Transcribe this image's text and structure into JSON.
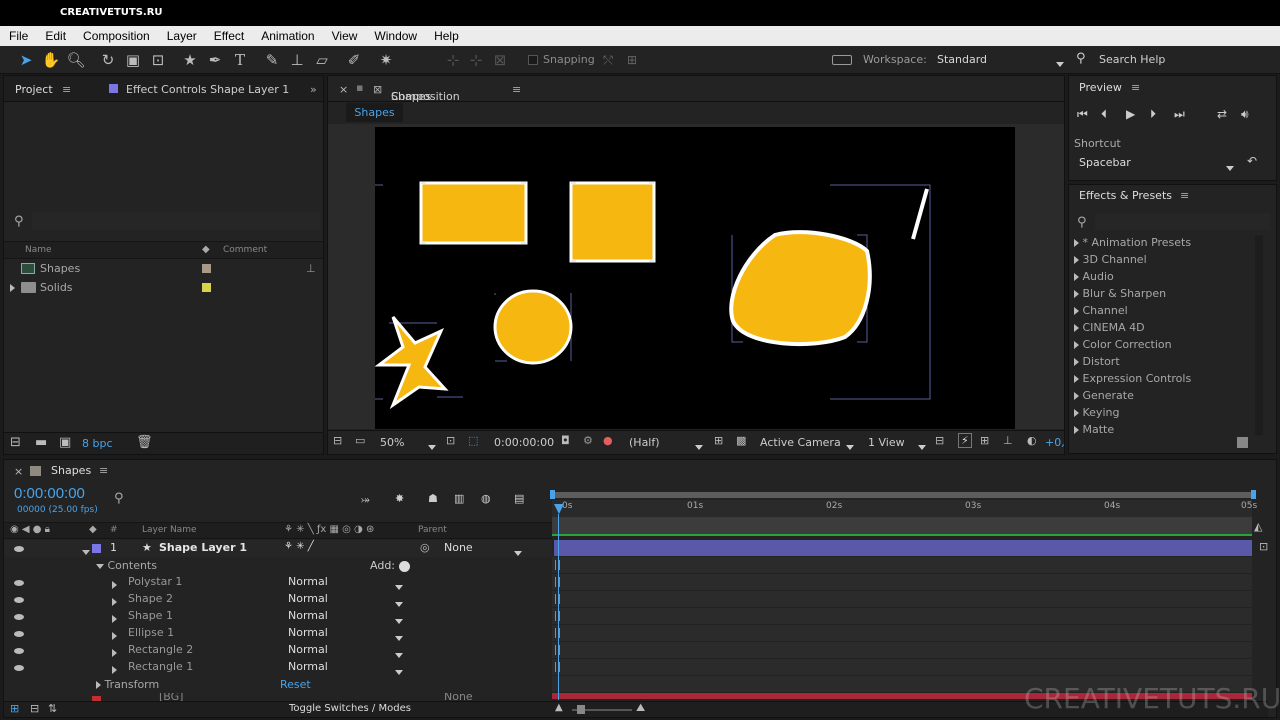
{
  "titlebar": {
    "title": "CREATIVETUTS.RU"
  },
  "menu": [
    "File",
    "Edit",
    "Composition",
    "Layer",
    "Effect",
    "Animation",
    "View",
    "Window",
    "Help"
  ],
  "toolbar": {
    "snapping": "Snapping",
    "workspace_label": "Workspace:",
    "workspace_value": "Standard",
    "search_help": "Search Help"
  },
  "project": {
    "tab_label": "Project",
    "effect_controls_tab": "Effect Controls Shape Layer 1",
    "col_name": "Name",
    "col_comment": "Comment",
    "items": [
      {
        "name": "Shapes",
        "color": "#a89a86"
      },
      {
        "name": "Solids",
        "color": "#d6d44a"
      }
    ],
    "bpc": "8 bpc"
  },
  "composition": {
    "tab_prefix": "Composition",
    "tab_name": "Shapes",
    "subtab": "Shapes",
    "zoom": "50%",
    "timecode": "0:00:00:00",
    "resolution": "(Half)",
    "camera": "Active Camera",
    "views": "1 View",
    "offset": "+0,"
  },
  "preview": {
    "title": "Preview",
    "shortcut_label": "Shortcut",
    "shortcut_value": "Spacebar"
  },
  "effects": {
    "title": "Effects & Presets",
    "items": [
      "* Animation Presets",
      "3D Channel",
      "Audio",
      "Blur & Sharpen",
      "Channel",
      "CINEMA 4D",
      "Color Correction",
      "Distort",
      "Expression Controls",
      "Generate",
      "Keying",
      "Matte"
    ]
  },
  "timeline": {
    "tab_label": "Shapes",
    "timecode": "0:00:00:00",
    "frames": "00000 (25.00 fps)",
    "col_hash": "#",
    "col_layer_name": "Layer Name",
    "col_parent": "Parent",
    "layer": {
      "index": "1",
      "name": "Shape Layer 1",
      "parent": "None",
      "color": "#7b76e6"
    },
    "contents_label": "Contents",
    "add_label": "Add:",
    "sublayers": [
      {
        "name": "Polystar 1",
        "mode": "Normal"
      },
      {
        "name": "Shape 2",
        "mode": "Normal"
      },
      {
        "name": "Shape 1",
        "mode": "Normal"
      },
      {
        "name": "Ellipse 1",
        "mode": "Normal"
      },
      {
        "name": "Rectangle 2",
        "mode": "Normal"
      },
      {
        "name": "Rectangle 1",
        "mode": "Normal"
      }
    ],
    "transform_label": "Transform",
    "reset_label": "Reset",
    "layer2_name": "[BG]",
    "layer2_parent": "None",
    "ruler": [
      "0s",
      "01s",
      "02s",
      "03s",
      "04s",
      "05s"
    ],
    "toggle_label": "Toggle Switches / Modes"
  },
  "watermark": "CREATIVETUTS.RU",
  "colors": {
    "accent": "#4aa3e8",
    "shape_fill": "#f7b711",
    "layer_bar": "#5a58a8",
    "playhead": "#4aa3e8"
  }
}
